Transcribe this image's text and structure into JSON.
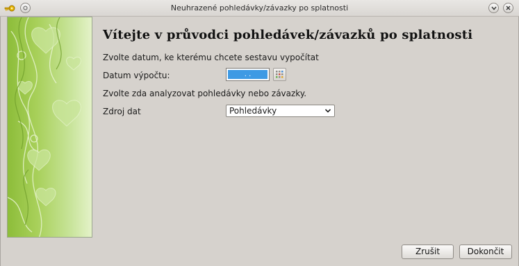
{
  "window": {
    "title": "Neuhrazené pohledávky/závazky po splatnosti"
  },
  "wizard": {
    "heading": "Vítejte v průvodci pohledávek/závazků po splatnosti",
    "date_instruction": "Zvolte datum,  ke kterému chcete sestavu vypočítat",
    "date_label": "Datum výpočtu:",
    "date_value": ". .",
    "source_instruction": "Zvolte zda analyzovat pohledávky nebo závazky.",
    "source_label": "Zdroj dat",
    "source_value": "Pohledávky"
  },
  "buttons": {
    "cancel": "Zrušit",
    "finish": "Dokončit"
  },
  "colors": {
    "selection": "#3e9ae4",
    "panel_green": "#a8d05a",
    "window_bg": "#d6d2cd"
  }
}
